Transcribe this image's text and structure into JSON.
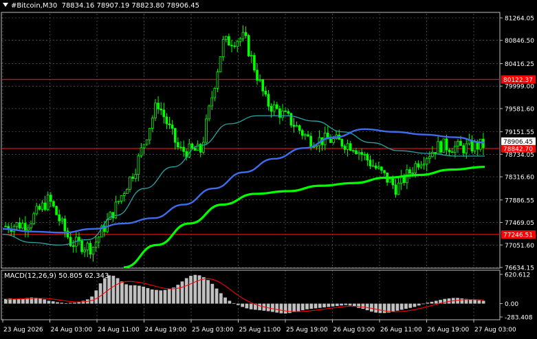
{
  "header": {
    "symbol": "#Bitcoin",
    "timeframe": "M30",
    "ohlc": "78834.16 78907.19 78823.80 78906.45"
  },
  "macd_label": {
    "name": "MACD(12,26,9)",
    "values": "50.805 62.343"
  },
  "colors": {
    "background": "#000000",
    "grid": "#c0c0c0",
    "bull_candle": "#00ff00",
    "ma_fast": "#2aa6a6",
    "ma_mid": "#3f6df0",
    "ma_slow": "#00ff00",
    "hline": "#ff0000",
    "macd_hist": "#c0c0c0",
    "macd_signal": "#ff0000"
  },
  "chart_data": {
    "type": "candlestick",
    "symbol": "#Bitcoin",
    "timeframe": "M30",
    "y_axis_ticks": [
      "81264.05",
      "80846.50",
      "80416.25",
      "79999.00",
      "79581.60",
      "79151.55",
      "78734.05",
      "78316.60",
      "77886.55",
      "77469.05",
      "77051.60",
      "76634.15"
    ],
    "ylim": [
      76634.15,
      81264.05
    ],
    "x_axis_ticks": [
      "23 Aug 2026",
      "24 Aug 03:00",
      "24 Aug 11:00",
      "24 Aug 19:00",
      "25 Aug 03:00",
      "25 Aug 11:00",
      "25 Aug 19:00",
      "26 Aug 03:00",
      "26 Aug 11:00",
      "26 Aug 19:00",
      "27 Aug 03:00"
    ],
    "horizontal_lines": [
      {
        "label": "80122.37",
        "value": 80122.37
      },
      {
        "label": "78842.70",
        "value": 78842.7
      },
      {
        "label": "77246.51",
        "value": 77246.51
      }
    ],
    "current_price_label": "78906.45",
    "close_path": [
      {
        "t": "23 Aug 2026",
        "v": 77400
      },
      {
        "t": "23 Aug 11:00",
        "v": 77450
      },
      {
        "t": "23 Aug 19:00",
        "v": 77900
      },
      {
        "t": "24 Aug 03:00",
        "v": 77100
      },
      {
        "t": "24 Aug 07:00",
        "v": 77000
      },
      {
        "t": "24 Aug 11:00",
        "v": 77700
      },
      {
        "t": "24 Aug 15:00",
        "v": 78500
      },
      {
        "t": "24 Aug 19:00",
        "v": 79700
      },
      {
        "t": "24 Aug 23:00",
        "v": 78800
      },
      {
        "t": "25 Aug 03:00",
        "v": 78800
      },
      {
        "t": "25 Aug 05:00",
        "v": 80800
      },
      {
        "t": "25 Aug 09:00",
        "v": 80900
      },
      {
        "t": "25 Aug 11:00",
        "v": 79700
      },
      {
        "t": "25 Aug 15:00",
        "v": 79400
      },
      {
        "t": "25 Aug 19:00",
        "v": 79000
      },
      {
        "t": "26 Aug 03:00",
        "v": 79000
      },
      {
        "t": "26 Aug 07:00",
        "v": 78900
      },
      {
        "t": "26 Aug 11:00",
        "v": 78500
      },
      {
        "t": "26 Aug 15:00",
        "v": 78100
      },
      {
        "t": "26 Aug 19:00",
        "v": 78600
      },
      {
        "t": "26 Aug 23:00",
        "v": 78900
      },
      {
        "t": "27 Aug 03:00",
        "v": 78850
      },
      {
        "t": "27 Aug 05:00",
        "v": 78906.45
      }
    ],
    "moving_averages": [
      {
        "color": "#2aa6a6",
        "values": [
          77250,
          77100,
          77050,
          77150,
          77600,
          78100,
          78500,
          78900,
          79300,
          79450,
          79450,
          79350,
          79150,
          78950,
          78800,
          78750,
          78700,
          78700
        ]
      },
      {
        "color": "#3f6df0",
        "values": [
          77350,
          77300,
          77280,
          77350,
          77450,
          77550,
          77800,
          78100,
          78400,
          78650,
          78850,
          79050,
          79200,
          79150,
          79100,
          79050,
          78950
        ]
      },
      {
        "color": "#00ff00",
        "values": [
          76634,
          77050,
          77450,
          77800,
          78000,
          78050,
          78150,
          78200,
          78300,
          78350,
          78450,
          78500
        ]
      }
    ],
    "macd": {
      "title": "MACD(12,26,9)",
      "values_label": "50.805 62.343",
      "y_axis_ticks": [
        "620.612",
        "0.00",
        "-283.408"
      ],
      "ylim": [
        -283.408,
        620.612
      ],
      "histogram": [
        100,
        110,
        90,
        100,
        105,
        120,
        130,
        125,
        110,
        90,
        60,
        50,
        30,
        20,
        10,
        15,
        20,
        40,
        60,
        90,
        150,
        280,
        430,
        540,
        600,
        590,
        540,
        470,
        410,
        390,
        390,
        380,
        360,
        330,
        300,
        290,
        280,
        290,
        310,
        340,
        400,
        470,
        540,
        590,
        610,
        600,
        560,
        500,
        420,
        320,
        220,
        130,
        60,
        10,
        -30,
        -70,
        -100,
        -120,
        -130,
        -140,
        -150,
        -160,
        -175,
        -190,
        -205,
        -210,
        -200,
        -180,
        -160,
        -140,
        -120,
        -110,
        -100,
        -90,
        -80,
        -70,
        -60,
        -50,
        -40,
        -30,
        -40,
        -60,
        -90,
        -110,
        -140,
        -170,
        -190,
        -200,
        -200,
        -190,
        -170,
        -150,
        -130,
        -110,
        -90,
        -70,
        -40,
        -10,
        20,
        40,
        60,
        80,
        100,
        110,
        120,
        120,
        110,
        100,
        90,
        80,
        70,
        60
      ],
      "signal": [
        90,
        95,
        98,
        100,
        102,
        105,
        108,
        112,
        114,
        112,
        105,
        95,
        82,
        68,
        55,
        45,
        38,
        36,
        40,
        50,
        70,
        110,
        170,
        240,
        310,
        370,
        420,
        455,
        470,
        470,
        462,
        450,
        432,
        410,
        385,
        360,
        338,
        322,
        314,
        316,
        328,
        352,
        386,
        426,
        466,
        500,
        524,
        530,
        514,
        480,
        430,
        368,
        300,
        232,
        168,
        110,
        60,
        18,
        -18,
        -48,
        -72,
        -92,
        -110,
        -126,
        -142,
        -156,
        -166,
        -170,
        -170,
        -166,
        -158,
        -148,
        -138,
        -126,
        -114,
        -102,
        -90,
        -78,
        -68,
        -58,
        -54,
        -56,
        -62,
        -72,
        -86,
        -102,
        -120,
        -138,
        -154,
        -166,
        -172,
        -172,
        -166,
        -156,
        -142,
        -126,
        -106,
        -84,
        -60,
        -36,
        -12,
        10,
        30,
        48,
        62,
        74,
        82,
        86,
        88,
        86,
        82,
        78
      ]
    }
  }
}
